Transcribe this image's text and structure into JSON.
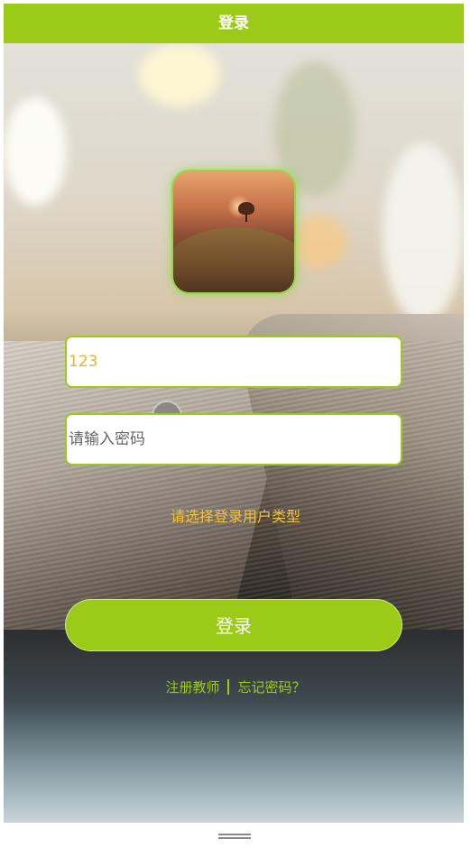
{
  "header": {
    "title": "登录"
  },
  "login_form": {
    "username_value": "123",
    "password_placeholder": "请输入密码",
    "usertype_label": "请选择登录用户类型",
    "submit_label": "登录"
  },
  "footer_links": {
    "register_teacher": "注册教师",
    "forgot_password": "忘记密码？"
  },
  "colors": {
    "accent": "#9ccb17",
    "highlight_text": "#f2c23d"
  }
}
